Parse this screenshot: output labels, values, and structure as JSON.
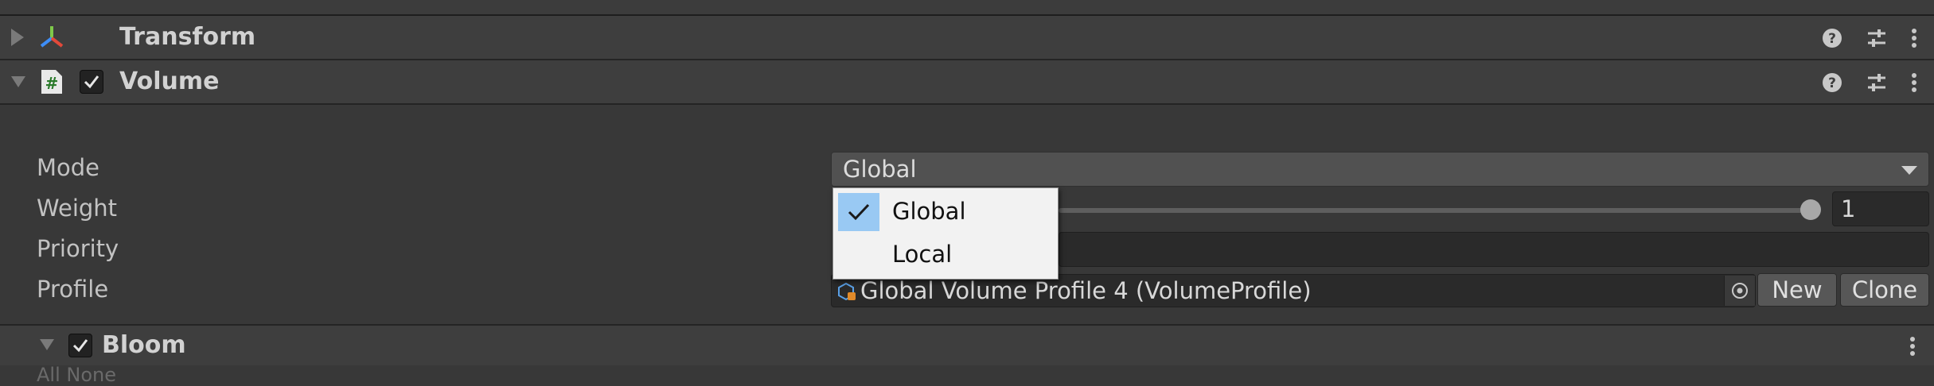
{
  "transform": {
    "title": "Transform"
  },
  "volume": {
    "title": "Volume",
    "enabled": true,
    "fields": {
      "mode_label": "Mode",
      "weight_label": "Weight",
      "priority_label": "Priority",
      "profile_label": "Profile",
      "mode_value": "Global",
      "weight_value": "1",
      "weight_fraction": 1.0,
      "profile_value": "Global Volume Profile 4 (VolumeProfile)"
    },
    "buttons": {
      "new_label": "New",
      "clone_label": "Clone"
    }
  },
  "mode_popup": {
    "options": [
      {
        "label": "Global",
        "selected": true
      },
      {
        "label": "Local",
        "selected": false
      }
    ]
  },
  "bloom": {
    "title": "Bloom",
    "enabled": true,
    "subtext": "All  None"
  },
  "icons": {
    "header": [
      "help-icon",
      "preset-icon",
      "more-icon"
    ],
    "transform": "transform-axes-icon",
    "volume": "script-icon"
  },
  "colors": {
    "selection": "#99c9f3",
    "background": "#383838",
    "header": "#3e3e3e"
  }
}
